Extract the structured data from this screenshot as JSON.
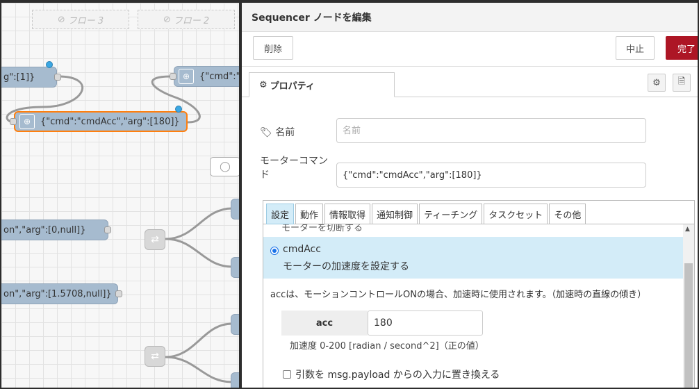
{
  "workspace": {
    "flow_tabs": [
      "フロー 3",
      "フロー 2"
    ],
    "nodes": {
      "arg1": "g\":[1]}",
      "cmd_right": "{\"cmd\":\"c",
      "cmd_acc": "{\"cmd\":\"cmdAcc\",\"arg\":[180]}",
      "arg_null": "on\",\"arg\":[0,null]}",
      "arg_15708": "on\",\"arg\":[1.5708,null]}"
    },
    "icons": {
      "disabled": "circle-slash-icon",
      "inject": "inject-icon",
      "switch": "switch-icon",
      "comment": "comment-icon"
    }
  },
  "tray": {
    "title": "Sequencer ノードを編集",
    "delete_label": "削除",
    "cancel_label": "中止",
    "done_label": "完了",
    "colors": {
      "primary": "#ad1625",
      "selected_bg": "#d3ecf8"
    },
    "properties_tab": "プロパティ",
    "name_label": "名前",
    "name_placeholder": "名前",
    "motor_cmd_label_line1": "モーターコマン",
    "motor_cmd_label_line2": "ド",
    "motor_cmd_value": "{\"cmd\":\"cmdAcc\",\"arg\":[180]}",
    "cmd_tabs": [
      "設定",
      "動作",
      "情報取得",
      "通知制御",
      "ティーチング",
      "タスクセット",
      "その他"
    ],
    "cut_line": "モーターを切断する",
    "selected_cmd": "cmdAcc",
    "selected_desc": "モーターの加速度を設定する",
    "acc_desc": "accは、モーションコントロールONの場合、加速時に使用されます。（加速時の直線の傾き）",
    "param_key": "acc",
    "param_value": "180",
    "param_hint": "加速度 0-200 [radian / second^2]（正の値）",
    "checkbox_label": "引数を msg.payload からの入力に置き換える"
  }
}
